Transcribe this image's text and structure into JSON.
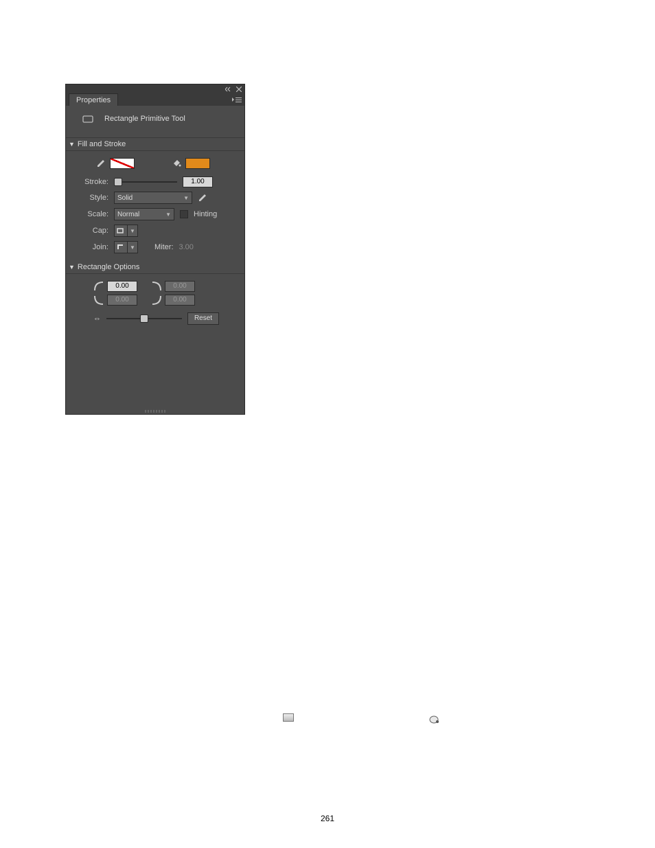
{
  "panel": {
    "tab_label": "Properties",
    "tool_name": "Rectangle Primitive Tool"
  },
  "fill_stroke": {
    "header": "Fill and Stroke",
    "stroke_label": "Stroke:",
    "stroke_value": "1.00",
    "style_label": "Style:",
    "style_value": "Solid",
    "scale_label": "Scale:",
    "scale_value": "Normal",
    "hinting_label": "Hinting",
    "cap_label": "Cap:",
    "join_label": "Join:",
    "miter_label": "Miter:",
    "miter_value": "3.00"
  },
  "rect_opts": {
    "header": "Rectangle Options",
    "tl": "0.00",
    "tr": "0.00",
    "bl": "0.00",
    "br": "0.00",
    "reset_label": "Reset"
  },
  "page_number": "261"
}
